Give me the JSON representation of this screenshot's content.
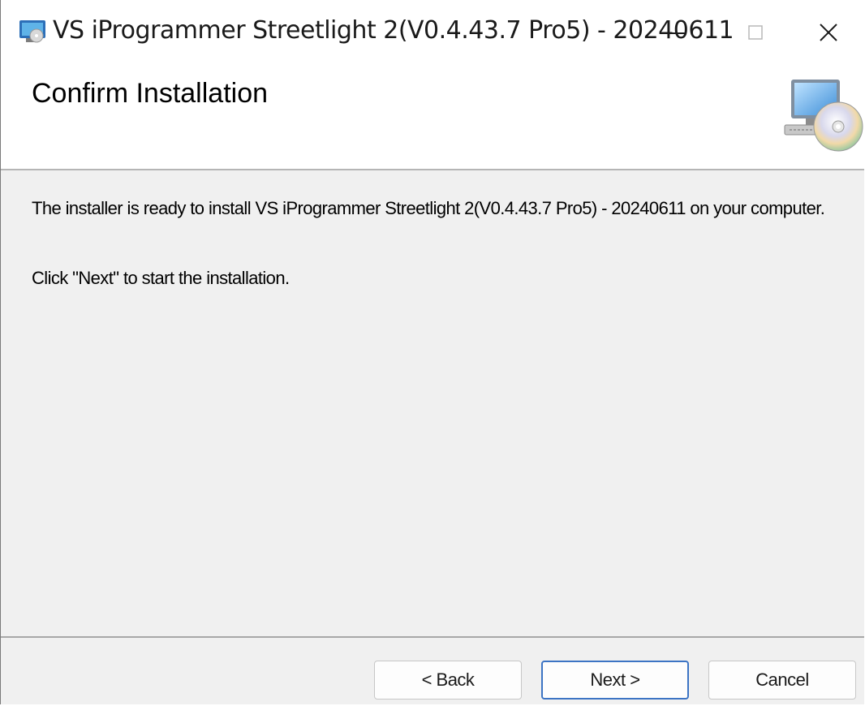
{
  "window": {
    "title": "VS iProgrammer Streetlight 2(V0.4.43.7 Pro5) - 20240611",
    "icon": "installer-app-icon"
  },
  "header": {
    "title": "Confirm Installation",
    "icon": "computer-cd-icon"
  },
  "body": {
    "message": "The installer is ready to install VS iProgrammer Streetlight 2(V0.4.43.7 Pro5) - 20240611 on your computer.",
    "instruction": "Click \"Next\" to start the installation."
  },
  "buttons": {
    "back": "< Back",
    "next": "Next >",
    "cancel": "Cancel"
  },
  "colors": {
    "accent": "#3c74c4",
    "background": "#f0f0f0"
  }
}
